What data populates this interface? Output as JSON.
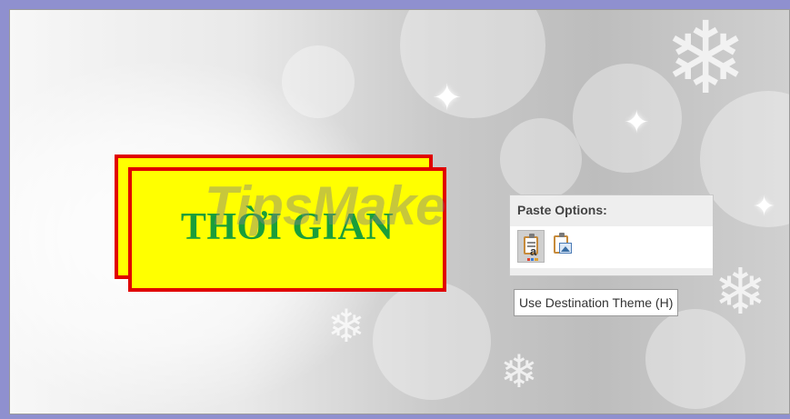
{
  "slide": {
    "title_text": "THỜI GIAN",
    "watermark_text": "TipsMake",
    "colors": {
      "title_fill": "#ffff00",
      "title_border": "#e00000",
      "title_text": "#1a9e3a"
    }
  },
  "paste_options": {
    "header": "Paste Options:",
    "buttons": [
      {
        "name": "Use Destination Theme",
        "icon": "clipboard-text-icon",
        "selected": true
      },
      {
        "name": "Picture",
        "icon": "clipboard-picture-icon",
        "selected": false
      }
    ],
    "tooltip": "Use Destination Theme (H)"
  }
}
